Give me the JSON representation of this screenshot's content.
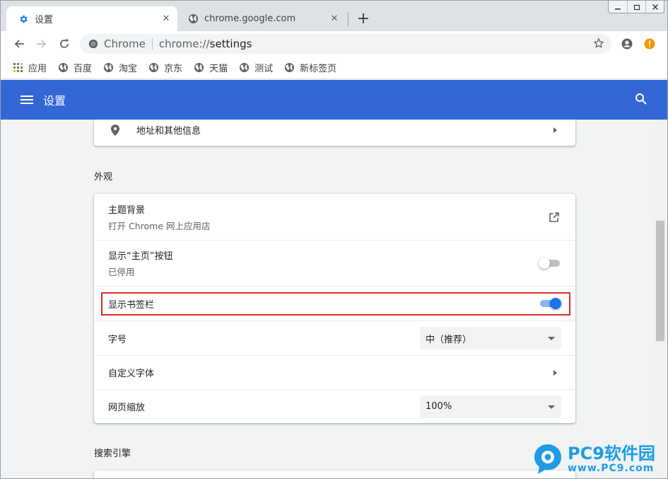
{
  "tabs": [
    {
      "title": "设置",
      "close": "✕"
    },
    {
      "title": "chrome.google.com",
      "close": "✕"
    }
  ],
  "new_tab": "+",
  "omnibox": {
    "label": "Chrome",
    "scheme": "chrome://",
    "path": "settings"
  },
  "bookmarks": {
    "apps": "应用",
    "items": [
      "百度",
      "淘宝",
      "京东",
      "天猫",
      "测试",
      "新标签页"
    ]
  },
  "header": {
    "title": "设置"
  },
  "autofill": {
    "addresses": "地址和其他信息"
  },
  "appearance": {
    "title": "外观",
    "theme": {
      "label": "主题背景",
      "sublabel": "打开 Chrome 网上应用店"
    },
    "home_button": {
      "label": "显示“主页”按钮",
      "sublabel": "已停用",
      "enabled": false
    },
    "bookmarks_bar": {
      "label": "显示书签栏",
      "enabled": true
    },
    "font_size": {
      "label": "字号",
      "value": "中（推荐）"
    },
    "custom_fonts": {
      "label": "自定义字体"
    },
    "page_zoom": {
      "label": "网页缩放",
      "value": "100%"
    }
  },
  "search_engine": {
    "title": "搜索引擎"
  },
  "watermark": {
    "brand": "PC9软件园",
    "url": "www.PC9.com"
  },
  "colors": {
    "header": "#3367d6",
    "accent": "#1a73e8",
    "highlight": "#d93025"
  }
}
